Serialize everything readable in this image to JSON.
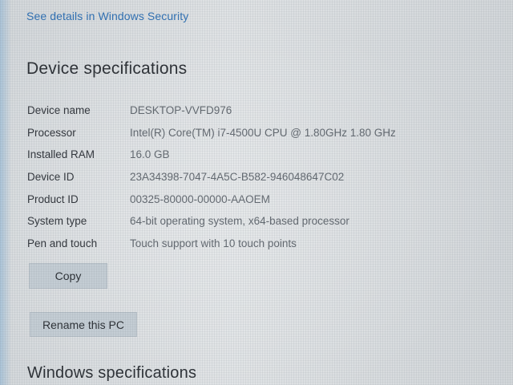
{
  "links": {
    "windows_security": "See details in Windows Security"
  },
  "device_specs": {
    "title": "Device specifications",
    "rows": [
      {
        "label": "Device name",
        "value": "DESKTOP-VVFD976"
      },
      {
        "label": "Processor",
        "value": "Intel(R) Core(TM) i7-4500U CPU @ 1.80GHz   1.80 GHz"
      },
      {
        "label": "Installed RAM",
        "value": "16.0 GB"
      },
      {
        "label": "Device ID",
        "value": "23A34398-7047-4A5C-B582-946048647C02"
      },
      {
        "label": "Product ID",
        "value": "00325-80000-00000-AAOEM"
      },
      {
        "label": "System type",
        "value": "64-bit operating system, x64-based processor"
      },
      {
        "label": "Pen and touch",
        "value": "Touch support with 10 touch points"
      }
    ],
    "copy_label": "Copy",
    "rename_label": "Rename this PC"
  },
  "windows_specs": {
    "title": "Windows specifications"
  }
}
